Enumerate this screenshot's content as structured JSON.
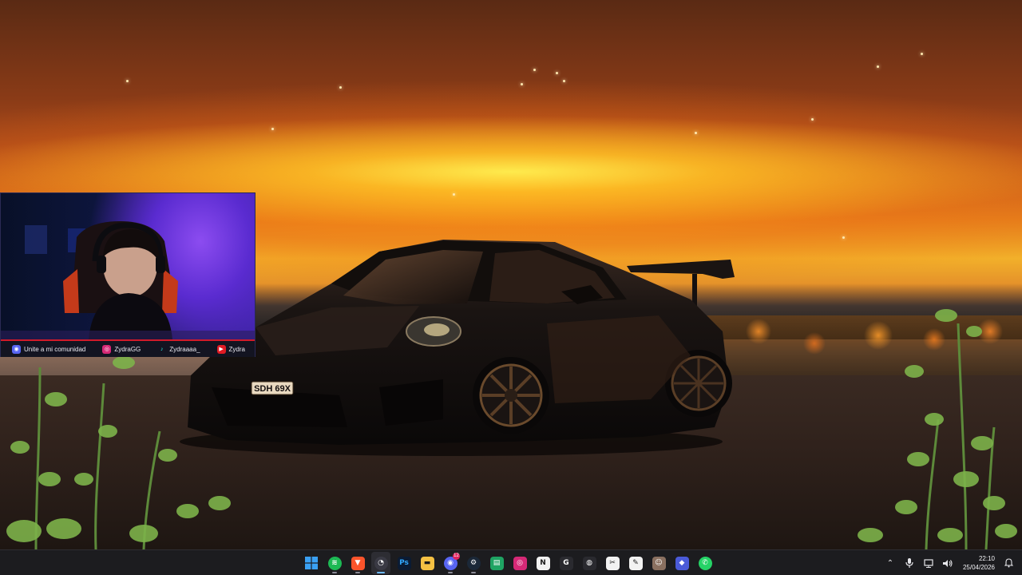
{
  "webcam": {
    "socials": [
      {
        "name": "discord",
        "label": "Unite a mi comunidad",
        "color": "#5865f2",
        "icon": "discord-icon"
      },
      {
        "name": "instagram",
        "label": "ZydraGG",
        "color": "#d62976",
        "icon": "instagram-icon"
      },
      {
        "name": "tiktok",
        "label": "Zydraaaa_",
        "color": "#111111",
        "icon": "tiktok-icon"
      },
      {
        "name": "youtube",
        "label": "Zydra",
        "color": "#e01b24",
        "icon": "youtube-icon"
      }
    ]
  },
  "car": {
    "plate": "SDH 69X"
  },
  "taskbar": {
    "apps": [
      {
        "name": "start",
        "icon": "windows-start-icon",
        "glyph": "",
        "color": "#3aa0f3",
        "active": false,
        "running": false
      },
      {
        "name": "spotify",
        "icon": "spotify-icon",
        "glyph": "≋",
        "color": "#1db954",
        "active": false,
        "running": true
      },
      {
        "name": "brave",
        "icon": "brave-browser-icon",
        "glyph": "▼",
        "color": "#fb542b",
        "active": false,
        "running": true
      },
      {
        "name": "app-recorder",
        "icon": "recorder-app-icon",
        "glyph": "◔",
        "color": "#3a3a44",
        "active": true,
        "running": true,
        "badge": ""
      },
      {
        "name": "photoshop",
        "icon": "photoshop-icon",
        "glyph": "Ps",
        "color": "#0b1b33",
        "active": false,
        "running": false
      },
      {
        "name": "file-explorer",
        "icon": "folder-icon",
        "glyph": "▬",
        "color": "#f5c143",
        "active": false,
        "running": false
      },
      {
        "name": "discord",
        "icon": "discord-icon",
        "glyph": "◉",
        "color": "#5865f2",
        "active": false,
        "running": true,
        "badge": "12"
      },
      {
        "name": "steam",
        "icon": "steam-icon",
        "glyph": "⚙",
        "color": "#1b2838",
        "active": false,
        "running": true
      },
      {
        "name": "sheets",
        "icon": "spreadsheet-icon",
        "glyph": "▤",
        "color": "#1fa463",
        "active": false,
        "running": false
      },
      {
        "name": "instagram",
        "icon": "instagram-icon",
        "glyph": "◎",
        "color": "#d62976",
        "active": false,
        "running": false
      },
      {
        "name": "notion",
        "icon": "notion-icon",
        "glyph": "N",
        "color": "#f2f2f2",
        "active": false,
        "running": false
      },
      {
        "name": "app-g",
        "icon": "g-app-icon",
        "glyph": "G",
        "color": "#2a2a2f",
        "active": false,
        "running": false
      },
      {
        "name": "obs",
        "icon": "obs-studio-icon",
        "glyph": "◍",
        "color": "#2a2a2f",
        "active": false,
        "running": false
      },
      {
        "name": "capcut",
        "icon": "capcut-icon",
        "glyph": "✂",
        "color": "#f2f2f2",
        "active": false,
        "running": false
      },
      {
        "name": "editor",
        "icon": "document-editor-icon",
        "glyph": "✎",
        "color": "#f2f2f2",
        "active": false,
        "running": false
      },
      {
        "name": "avatar-app",
        "icon": "profile-app-icon",
        "glyph": "☺",
        "color": "#8a7060",
        "active": false,
        "running": false
      },
      {
        "name": "app-diamond",
        "icon": "diamond-app-icon",
        "glyph": "◆",
        "color": "#4a5ad8",
        "active": false,
        "running": false
      },
      {
        "name": "whatsapp",
        "icon": "whatsapp-icon",
        "glyph": "✆",
        "color": "#25d366",
        "active": false,
        "running": false
      }
    ],
    "clock": {
      "time": "22:10",
      "date": "25/04/2026"
    }
  }
}
